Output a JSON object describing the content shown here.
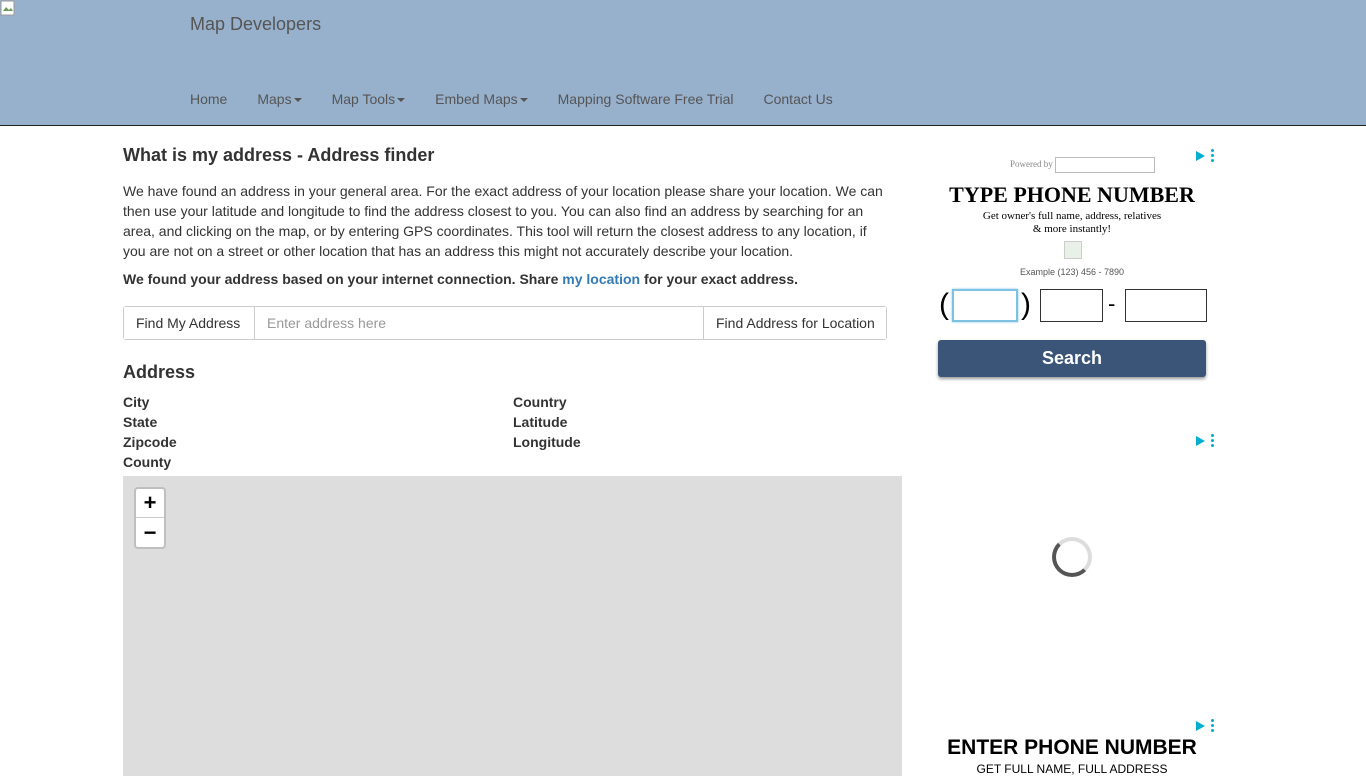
{
  "header": {
    "brand": "Map Developers",
    "nav": [
      {
        "label": "Home",
        "dropdown": false
      },
      {
        "label": "Maps",
        "dropdown": true
      },
      {
        "label": "Map Tools",
        "dropdown": true
      },
      {
        "label": "Embed Maps",
        "dropdown": true
      },
      {
        "label": "Mapping Software Free Trial",
        "dropdown": false
      },
      {
        "label": "Contact Us",
        "dropdown": false
      }
    ]
  },
  "main": {
    "title": "What is my address - Address finder",
    "intro": "We have found an address in your general area. For the exact address of your location please share your location. We can then use your latitude and longitude to find the address closest to you. You can also find an address by searching for an area, and clicking on the map, or by entering GPS coordinates. This tool will return the closest address to any location, if you are not on a street or other location that has an address this might not accurately describe your location.",
    "found_prefix": "We found your address based on your internet connection. Share ",
    "found_link": "my location",
    "found_suffix": " for your exact address.",
    "search": {
      "find_my_address": "Find My Address",
      "placeholder": "Enter address here",
      "find_for_location": "Find Address for Location"
    },
    "address": {
      "heading": "Address",
      "labels_left": [
        "City",
        "State",
        "Zipcode",
        "County"
      ],
      "labels_right": [
        "Country",
        "Latitude",
        "Longitude"
      ]
    },
    "map": {
      "zoom_in": "+",
      "zoom_out": "−"
    }
  },
  "ads": {
    "ad1": {
      "powered_by": "Powered by",
      "headline": "TYPE PHONE NUMBER",
      "sub_line1": "Get owner's full name, address, relatives",
      "sub_line2": "& more instantly!",
      "example": "Example (123) 456 - 7890",
      "open_paren": "(",
      "close_paren": ")",
      "dash": "-",
      "search_label": "Search"
    },
    "ad3": {
      "headline": "ENTER PHONE NUMBER",
      "sub": "GET FULL NAME, FULL ADDRESS"
    }
  }
}
